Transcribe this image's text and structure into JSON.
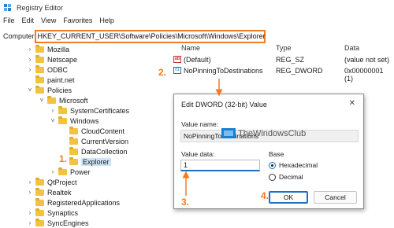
{
  "window": {
    "title": "Registry Editor"
  },
  "menu": [
    "File",
    "Edit",
    "View",
    "Favorites",
    "Help"
  ],
  "address": {
    "label": "Computer",
    "path": "HKEY_CURRENT_USER\\Software\\Policies\\Microsoft\\Windows\\Explorer"
  },
  "tree": [
    {
      "label": "Mozilla",
      "expanded": false
    },
    {
      "label": "Netscape",
      "expanded": false
    },
    {
      "label": "ODBC",
      "expanded": false
    },
    {
      "label": "paint.net",
      "expanded": false
    },
    {
      "label": "Policies",
      "expanded": true
    },
    {
      "label": "Microsoft",
      "expanded": true
    },
    {
      "label": "SystemCertificates",
      "expanded": false
    },
    {
      "label": "Windows",
      "expanded": true
    },
    {
      "label": "CloudContent",
      "expanded": false
    },
    {
      "label": "CurrentVersion",
      "expanded": false
    },
    {
      "label": "DataCollection",
      "expanded": false
    },
    {
      "label": "Explorer",
      "expanded": false
    },
    {
      "label": "Power",
      "expanded": false
    },
    {
      "label": "QtProject",
      "expanded": false
    },
    {
      "label": "Realtek",
      "expanded": false
    },
    {
      "label": "RegisteredApplications",
      "expanded": false
    },
    {
      "label": "Synaptics",
      "expanded": false
    },
    {
      "label": "SyncEngines",
      "expanded": false
    }
  ],
  "list": {
    "headers": {
      "name": "Name",
      "type": "Type",
      "data": "Data"
    },
    "rows": [
      {
        "icon": "string-value-icon",
        "name": "(Default)",
        "type": "REG_SZ",
        "data": "(value not set)"
      },
      {
        "icon": "binary-value-icon",
        "name": "NoPinningToDestinations",
        "type": "REG_DWORD",
        "data": "0x00000001 (1)"
      }
    ]
  },
  "dialog": {
    "title": "Edit DWORD (32-bit) Value",
    "close": "✕",
    "value_name_label": "Value name:",
    "value_name": "NoPinningToDestinations",
    "value_data_label": "Value data:",
    "value_data": "1",
    "base_label": "Base",
    "options": [
      "Hexadecimal",
      "Decimal"
    ],
    "selected_option": "Hexadecimal",
    "ok": "OK",
    "cancel": "Cancel"
  },
  "annotations": [
    "1.",
    "2.",
    "3.",
    "4."
  ],
  "watermark": "TheWindowsClub",
  "colors": {
    "annotation": "#f47b20",
    "folder": "#f0c341",
    "selection": "#cce4f7",
    "accent": "#1f6fc0"
  }
}
